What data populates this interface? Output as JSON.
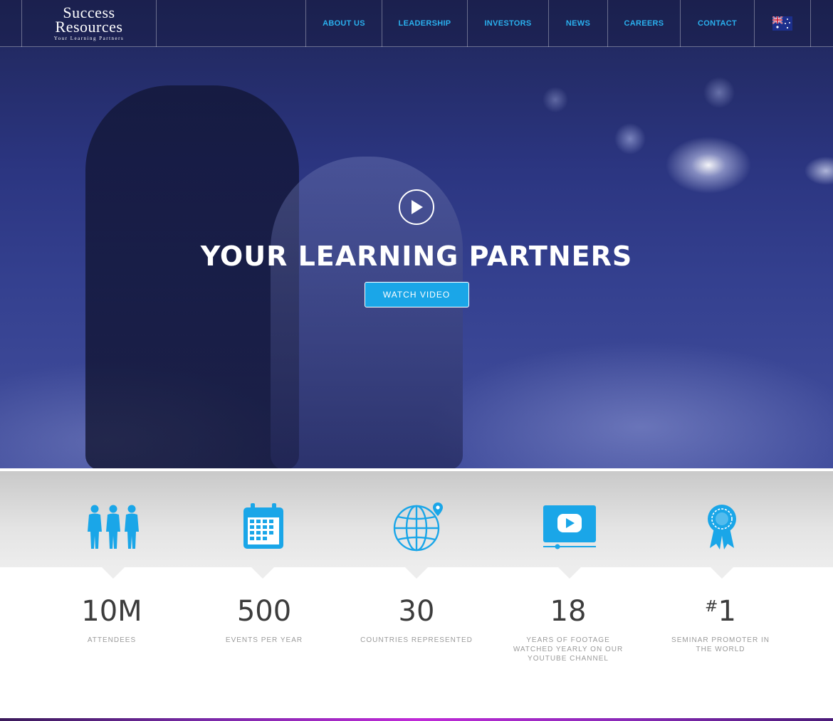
{
  "brand": {
    "line1": "Success",
    "line2": "Resources",
    "tagline": "Your Learning Partners"
  },
  "nav": {
    "items": [
      {
        "label": "ABOUT US"
      },
      {
        "label": "LEADERSHIP"
      },
      {
        "label": "INVESTORS"
      },
      {
        "label": "NEWS"
      },
      {
        "label": "CAREERS"
      },
      {
        "label": "CONTACT"
      }
    ],
    "flag_icon": "australia-flag-icon"
  },
  "hero": {
    "play_icon": "play-icon",
    "title": "YOUR LEARNING PARTNERS",
    "cta_label": "WATCH VIDEO"
  },
  "stats": [
    {
      "icon": "people-icon",
      "value": "10M",
      "label": "ATTENDEES"
    },
    {
      "icon": "calendar-icon",
      "value": "500",
      "label": "EVENTS PER YEAR"
    },
    {
      "icon": "globe-pin-icon",
      "value": "30",
      "label": "COUNTRIES REPRESENTED"
    },
    {
      "icon": "youtube-play-icon",
      "value": "18",
      "label": "YEARS OF FOOTAGE WATCHED YEARLY ON OUR YOUTUBE CHANNEL"
    },
    {
      "icon": "award-ribbon-icon",
      "value_prefix": "#",
      "value": "1",
      "label": "SEMINAR PROMOTER IN THE WORLD"
    }
  ],
  "colors": {
    "accent": "#1aa6e8",
    "nav_text": "#2ab0ee",
    "hero_tint": "#2b3580",
    "stat_number": "#3c3c3c",
    "stat_label": "#9a9a9a"
  }
}
